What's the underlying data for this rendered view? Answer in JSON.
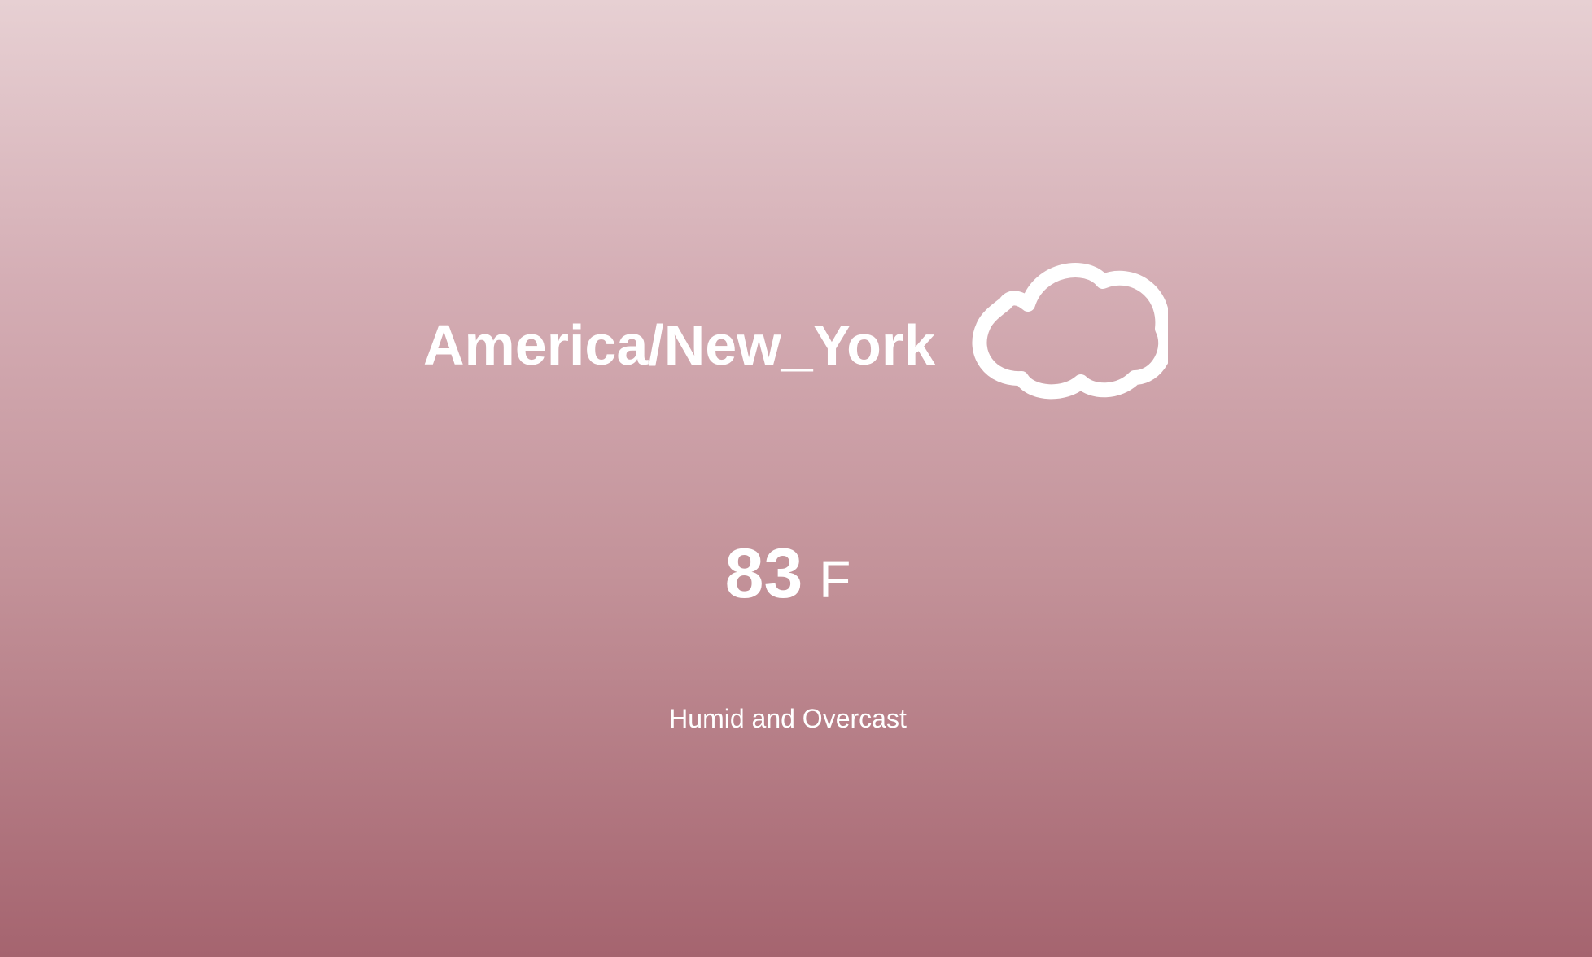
{
  "weather": {
    "location": "America/New_York",
    "temperature": "83",
    "unit": "F",
    "condition": "Humid and Overcast",
    "icon": "cloud-icon"
  },
  "colors": {
    "text": "#ffffff",
    "background_top": "#e7d0d3",
    "background_bottom": "#a5646f"
  }
}
